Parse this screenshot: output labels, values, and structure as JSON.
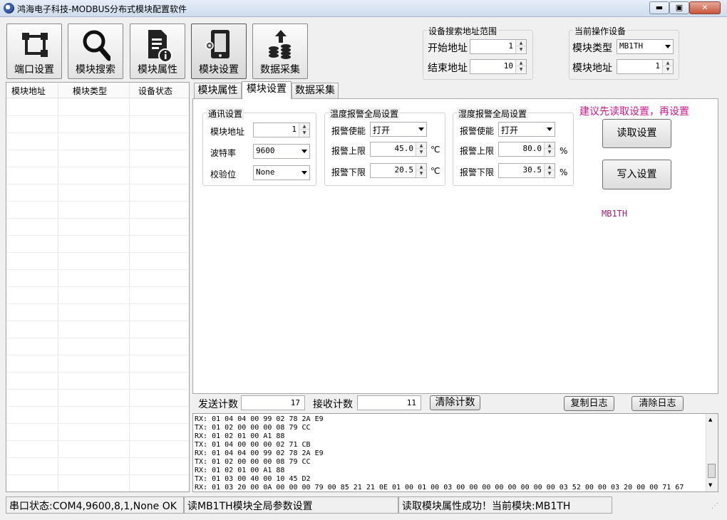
{
  "window": {
    "title": "鸿海电子科技-MODBUS分布式模块配置软件",
    "minimize": "▬",
    "maximize": "▣",
    "close": "✕"
  },
  "toolbar": {
    "port_settings": "端口设置",
    "module_search": "模块搜索",
    "module_properties": "模块属性",
    "module_settings": "模块设置",
    "data_acquisition": "数据采集"
  },
  "search_range": {
    "group_title": "设备搜索地址范围",
    "start_label": "开始地址",
    "start_value": "1",
    "end_label": "结束地址",
    "end_value": "10"
  },
  "current_device": {
    "group_title": "当前操作设备",
    "type_label": "模块类型",
    "type_value": "MB1TH",
    "addr_label": "模块地址",
    "addr_value": "1"
  },
  "device_list": {
    "columns": [
      "模块地址",
      "模块类型",
      "设备状态"
    ]
  },
  "tabs": [
    "模块属性",
    "模块设置",
    "数据采集"
  ],
  "comm": {
    "group_title": "通讯设置",
    "addr_label": "模块地址",
    "addr_value": "1",
    "baud_label": "波特率",
    "baud_value": "9600",
    "parity_label": "校验位",
    "parity_value": "None"
  },
  "temp_alarm": {
    "group_title": "温度报警全局设置",
    "enable_label": "报警使能",
    "enable_value": "打开",
    "upper_label": "报警上限",
    "upper_value": "45.0",
    "lower_label": "报警下限",
    "lower_value": "20.5",
    "unit": "℃"
  },
  "hum_alarm": {
    "group_title": "湿度报警全局设置",
    "enable_label": "报警使能",
    "enable_value": "打开",
    "upper_label": "报警上限",
    "upper_value": "80.0",
    "lower_label": "报警下限",
    "lower_value": "30.5",
    "unit": "%"
  },
  "hint": "建议先读取设置，再设置",
  "read_button": "读取设置",
  "write_button": "写入设置",
  "module_name": "MB1TH",
  "counters": {
    "send_label": "发送计数",
    "send_value": "17",
    "recv_label": "接收计数",
    "recv_value": "11",
    "clear_counts": "清除计数",
    "copy_log": "复制日志",
    "clear_log": "清除日志"
  },
  "log": [
    "RX: 01 04 04 00 99 02 78 2A E9",
    "TX: 01 02 00 00 00 08 79 CC",
    "RX: 01 02 01 00 A1 88",
    "TX: 01 04 00 00 00 02 71 CB",
    "RX: 01 04 04 00 99 02 78 2A E9",
    "TX: 01 02 00 00 00 08 79 CC",
    "RX: 01 02 01 00 A1 88",
    "TX: 01 03 00 40 00 10 45 D2",
    "RX: 01 03 20 00 0A 00 00 00 79 00 85 21 21 0E 01 00 01 00 03 00 00 00 00 00 00 00 00 03 52 00 00 03 20 00 00 71 67"
  ],
  "status": {
    "port": "串口状态:COM4,9600,8,1,None OK",
    "action": "读MB1TH模块全局参数设置",
    "result": "读取模块属性成功！当前模块:MB1TH"
  },
  "colors": {
    "hint": "#d4148c",
    "module_name": "#9c1c7c"
  }
}
